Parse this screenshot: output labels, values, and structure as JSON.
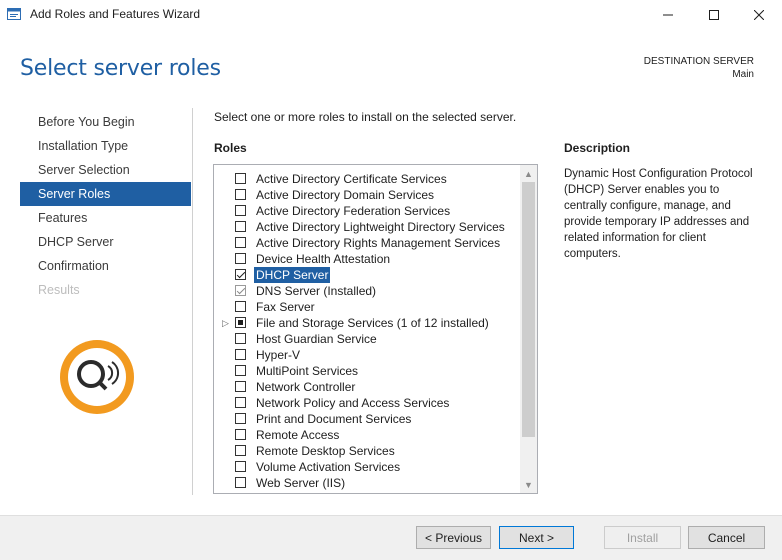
{
  "window": {
    "title": "Add Roles and Features Wizard",
    "controls": {
      "minimize": "minimize",
      "maximize": "maximize",
      "close": "close"
    }
  },
  "header": {
    "page_title": "Select server roles",
    "destination_label": "DESTINATION SERVER",
    "destination_value": "Main"
  },
  "nav": {
    "items": [
      {
        "label": "Before You Begin",
        "state": "normal"
      },
      {
        "label": "Installation Type",
        "state": "normal"
      },
      {
        "label": "Server Selection",
        "state": "normal"
      },
      {
        "label": "Server Roles",
        "state": "active"
      },
      {
        "label": "Features",
        "state": "normal"
      },
      {
        "label": "DHCP Server",
        "state": "normal"
      },
      {
        "label": "Confirmation",
        "state": "normal"
      },
      {
        "label": "Results",
        "state": "disabled"
      }
    ]
  },
  "main": {
    "intro": "Select one or more roles to install on the selected server.",
    "roles_heading": "Roles",
    "roles": [
      {
        "label": "Active Directory Certificate Services",
        "state": "unchecked"
      },
      {
        "label": "Active Directory Domain Services",
        "state": "unchecked"
      },
      {
        "label": "Active Directory Federation Services",
        "state": "unchecked"
      },
      {
        "label": "Active Directory Lightweight Directory Services",
        "state": "unchecked"
      },
      {
        "label": "Active Directory Rights Management Services",
        "state": "unchecked"
      },
      {
        "label": "Device Health Attestation",
        "state": "unchecked"
      },
      {
        "label": "DHCP Server",
        "state": "checked",
        "selected": true
      },
      {
        "label": "DNS Server (Installed)",
        "state": "checked-installed"
      },
      {
        "label": "Fax Server",
        "state": "unchecked"
      },
      {
        "label": "File and Storage Services (1 of 12 installed)",
        "state": "partial",
        "expandable": true
      },
      {
        "label": "Host Guardian Service",
        "state": "unchecked"
      },
      {
        "label": "Hyper-V",
        "state": "unchecked"
      },
      {
        "label": "MultiPoint Services",
        "state": "unchecked"
      },
      {
        "label": "Network Controller",
        "state": "unchecked"
      },
      {
        "label": "Network Policy and Access Services",
        "state": "unchecked"
      },
      {
        "label": "Print and Document Services",
        "state": "unchecked"
      },
      {
        "label": "Remote Access",
        "state": "unchecked"
      },
      {
        "label": "Remote Desktop Services",
        "state": "unchecked"
      },
      {
        "label": "Volume Activation Services",
        "state": "unchecked"
      },
      {
        "label": "Web Server (IIS)",
        "state": "unchecked"
      }
    ],
    "description_heading": "Description",
    "description_text": "Dynamic Host Configuration Protocol (DHCP) Server enables you to centrally configure, manage, and provide temporary IP addresses and related information for client computers."
  },
  "footer": {
    "previous_label": "< Previous",
    "next_label": "Next >",
    "install_label": "Install",
    "cancel_label": "Cancel"
  },
  "colors": {
    "accent": "#1f5fa3",
    "footer_bg": "#f0f0f0"
  }
}
